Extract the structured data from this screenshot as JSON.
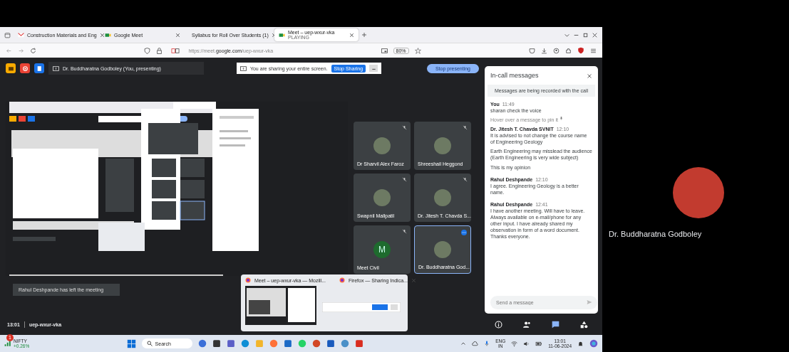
{
  "browser": {
    "tabs": [
      {
        "title": "Construction Materials and Eng",
        "selected": false
      },
      {
        "title": "Google Meet",
        "selected": false
      },
      {
        "title": "Syllabus for Roll Over Students (1)",
        "selected": false
      },
      {
        "title": "Meet – uep-wxur-vka",
        "subtitle": "PLAYING",
        "selected": true
      }
    ],
    "url_host": "https://meet.",
    "url_domain": "google.com",
    "url_path": "/uep-wxur-vka",
    "zoom": "80%"
  },
  "meet": {
    "presenter": "Dr. Buddharatna Godboley (You, presenting)",
    "share_banner": {
      "text": "You are sharing your entire screen.",
      "button": "Stop Sharing"
    },
    "stop_presenting": "Stop presenting",
    "tiles": [
      {
        "name": "Dr Sharvil Alex Faroz",
        "kind": "photo",
        "selected": false
      },
      {
        "name": "Shreeshail Heggond",
        "kind": "photo",
        "selected": false
      },
      {
        "name": "Swapnil Mallpatil",
        "kind": "photo",
        "selected": false
      },
      {
        "name": "Dr. Jitesh T. Chavda S...",
        "kind": "photo",
        "selected": false
      },
      {
        "name": "Meet Civil",
        "kind": "letter",
        "letter": "M",
        "selected": false
      },
      {
        "name": "Dr. Buddharatna God...",
        "kind": "photo",
        "selected": true
      }
    ],
    "chat": {
      "title": "In-call messages",
      "notice": "Messages are being recorded with the call",
      "messages": [
        {
          "sender": "You",
          "time": "11:49",
          "paragraphs": [
            "sharan check the voice"
          ],
          "hint": "Hover over a message to pin it"
        },
        {
          "sender": "Dr. Jitesh T. Chavda SVNIT",
          "time": "12:10",
          "paragraphs": [
            "It is advised to not change the course name of Engineering Geology",
            "Earth Engineering may misslead the audience (Earth Engineering is very wide subject)",
            "This is my opinion"
          ]
        },
        {
          "sender": "Rahul Deshpande",
          "time": "12:10",
          "paragraphs": [
            "I agree. Engineering Geology is a better name."
          ]
        },
        {
          "sender": "Rahul Deshpande",
          "time": "12:41",
          "paragraphs": [
            "I have another meeting. Will have to leave. Always available on e-mail/phone for any other input. I have already shared my observation in form of a word document. Thanks everyone."
          ]
        }
      ],
      "placeholder": "Send a message"
    },
    "toast": "Rahul Deshpande has left the meeting",
    "meeting_time": "13:01",
    "meeting_code": "uep-wxur-vka",
    "taskbar_preview": [
      "Meet – uep-wxur-vka — Mozill...",
      "Firefox — Sharing Indica..."
    ]
  },
  "taskbar": {
    "ticker_badge": "1",
    "ticker": "NIFTY",
    "change": "+0.26%",
    "search": "Search",
    "lang": "ENG",
    "region": "IN",
    "time": "13:01",
    "date": "11-06-2024"
  },
  "speaker": {
    "name": "Dr. Buddharatna Godboley"
  }
}
